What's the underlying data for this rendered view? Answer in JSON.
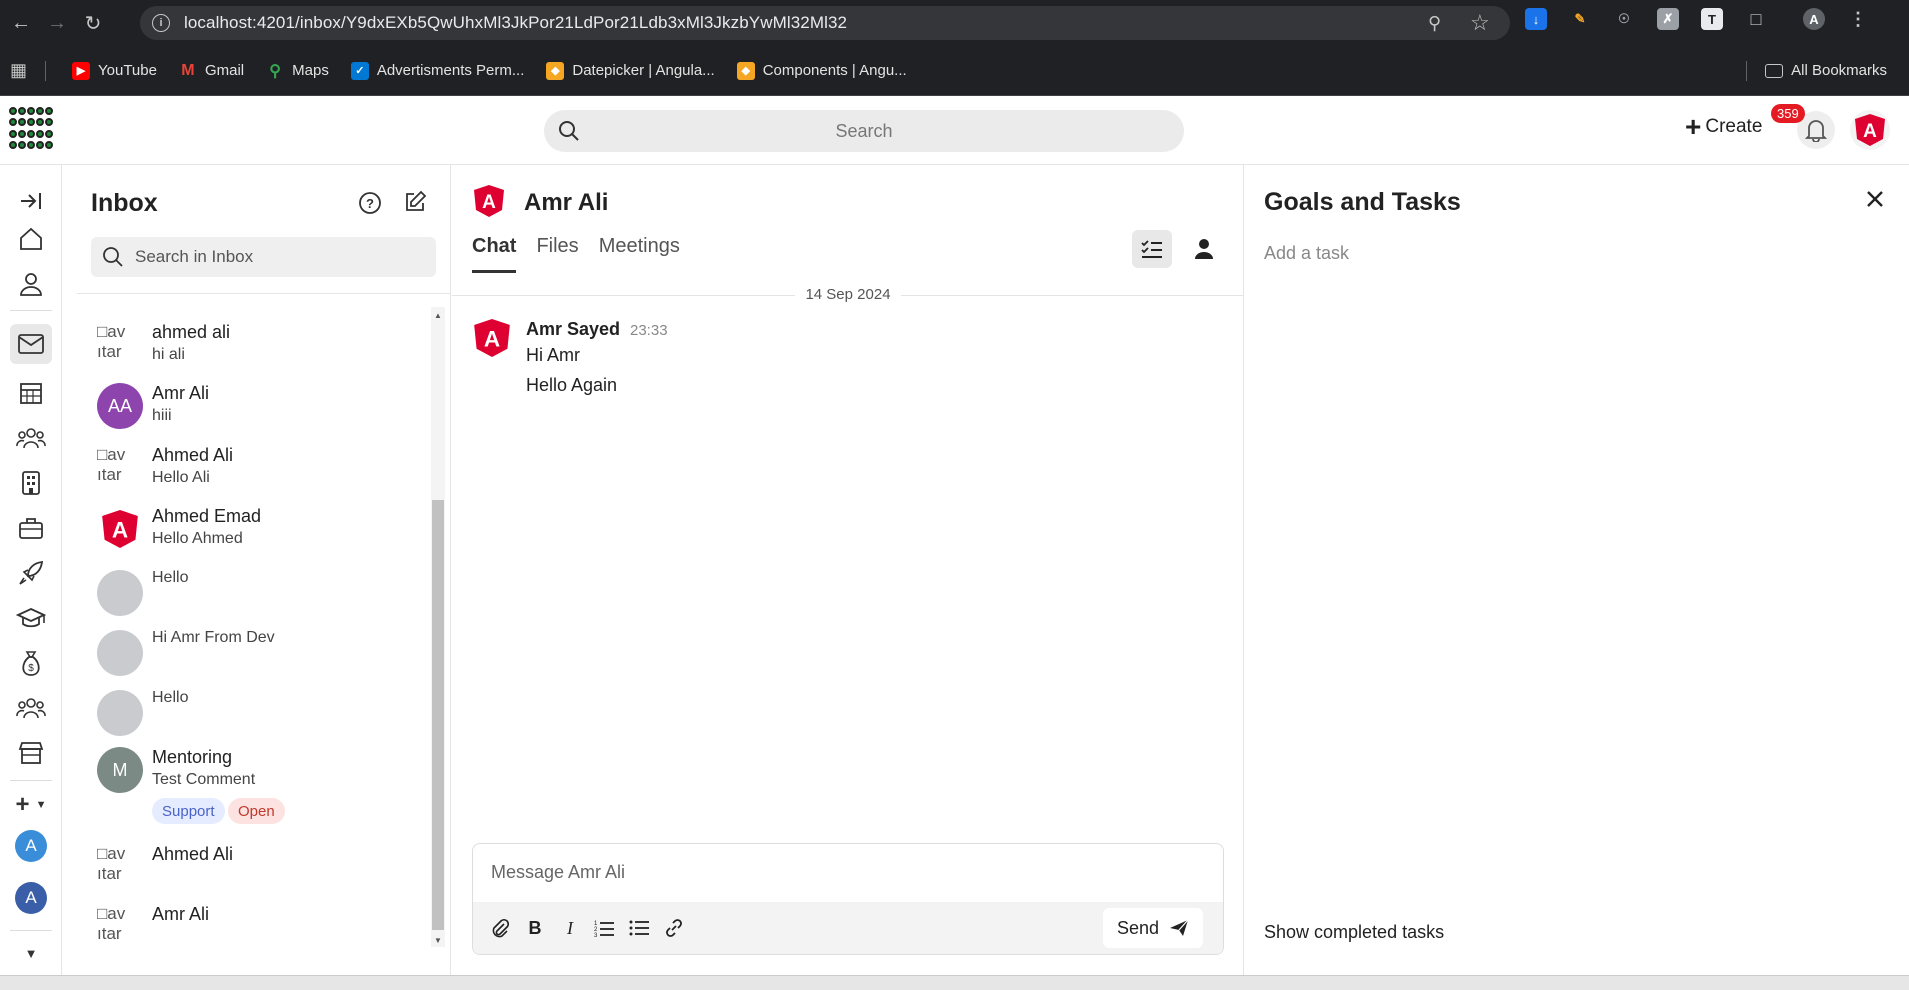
{
  "browser": {
    "url": "localhost:4201/inbox/Y9dxEXb5QwUhxMl3JkPor21LdPor21Ldb3xMl3JkzbYwMl32Ml32",
    "bookmarks": [
      {
        "label": "YouTube",
        "icon": "youtube-icon",
        "color": "#ff0000"
      },
      {
        "label": "Gmail",
        "icon": "gmail-icon",
        "color": "#ea4335"
      },
      {
        "label": "Maps",
        "icon": "maps-icon",
        "color": "#34a853"
      },
      {
        "label": "Advertisments Perm...",
        "icon": "azure-devops-icon",
        "color": "#0078d4"
      },
      {
        "label": "Datepicker | Angula...",
        "icon": "shield-icon",
        "color": "#f5a623"
      },
      {
        "label": "Components | Angu...",
        "icon": "shield-icon",
        "color": "#f5a623"
      }
    ],
    "all_bookmarks": "All Bookmarks",
    "profile_initial": "A"
  },
  "header": {
    "search_placeholder": "Search",
    "create_label": "Create",
    "notification_count": "359"
  },
  "rail": {
    "avatars": [
      {
        "initial": "A",
        "color": "#3a8ed9"
      },
      {
        "initial": "A",
        "color": "#3a5fa8"
      }
    ]
  },
  "inbox": {
    "title": "Inbox",
    "search_placeholder": "Search in Inbox",
    "broken_avatar_text": "av​tar",
    "conversations": [
      {
        "name": "ahmed ali",
        "preview": "hi ali",
        "avatar": "broken"
      },
      {
        "name": "Amr Ali",
        "preview": "hiii",
        "avatar": "initials",
        "initials": "AA",
        "color": "#8e44ad"
      },
      {
        "name": "Ahmed Ali",
        "preview": "Hello Ali",
        "avatar": "broken"
      },
      {
        "name": "Ahmed Emad",
        "preview": "Hello Ahmed",
        "avatar": "angular"
      },
      {
        "name": "",
        "preview": "Hello",
        "avatar": "blank"
      },
      {
        "name": "",
        "preview": "Hi Amr From Dev",
        "avatar": "blank"
      },
      {
        "name": "",
        "preview": "Hello",
        "avatar": "blank"
      },
      {
        "name": "Mentoring",
        "preview": "Test Comment",
        "avatar": "initials",
        "initials": "M",
        "color": "#7b8a84",
        "tags": [
          "Support",
          "Open"
        ]
      },
      {
        "name": "Ahmed Ali",
        "preview": "",
        "avatar": "broken"
      },
      {
        "name": "Amr Ali",
        "preview": "",
        "avatar": "broken"
      }
    ]
  },
  "chat": {
    "title": "Amr Ali",
    "tabs": [
      "Chat",
      "Files",
      "Meetings"
    ],
    "date": "14 Sep 2024",
    "message": {
      "sender": "Amr Sayed",
      "time": "23:33",
      "lines": [
        "Hi Amr",
        "Hello Again"
      ]
    },
    "composer_placeholder": "Message Amr Ali",
    "send_label": "Send"
  },
  "goals": {
    "title": "Goals and Tasks",
    "add_task_placeholder": "Add a task",
    "show_completed": "Show completed tasks"
  },
  "colors": {
    "angular_red": "#dd0031",
    "support_tag_bg": "#e6ecff",
    "support_tag_text": "#4a63c9",
    "open_tag_bg": "#fde2e2",
    "open_tag_text": "#c0392b"
  }
}
